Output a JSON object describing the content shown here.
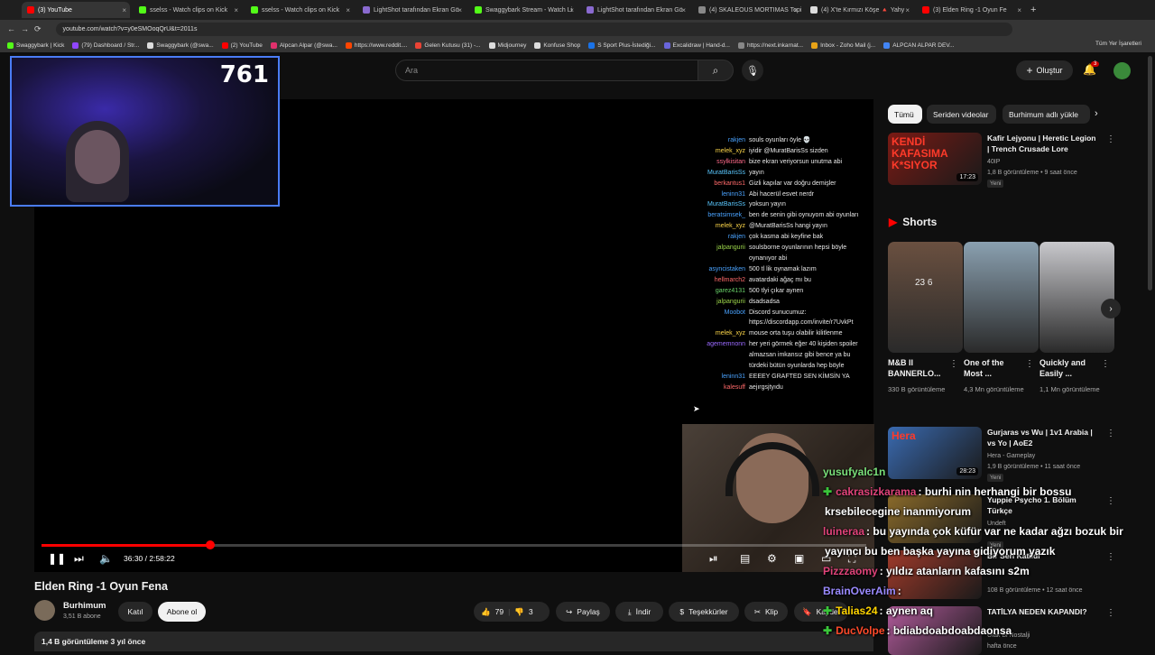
{
  "browser": {
    "tabs": [
      {
        "label": "(3) YouTube",
        "color": "#ff0000"
      },
      {
        "label": "sselss - Watch clips on Kick",
        "color": "#53fc18"
      },
      {
        "label": "sselss - Watch clips on Kick",
        "color": "#53fc18"
      },
      {
        "label": "LightShot tarafından Ekran Gö",
        "color": "#8a6ad0"
      },
      {
        "label": "Swaggybark Stream - Watch Li",
        "color": "#53fc18"
      },
      {
        "label": "LightShot tarafından Ekran Gö",
        "color": "#8a6ad0"
      },
      {
        "label": "(4) SKALEOUS MORTIMAS Topi",
        "color": "#888888"
      },
      {
        "label": "(4) X'te Kırmızı Köşe 🔺 Yahy",
        "color": "#dddddd"
      },
      {
        "label": "(3) Elden Ring -1 Oyun Fe",
        "color": "#ff0000"
      }
    ],
    "new_tab": "+",
    "nav": {
      "back": "←",
      "forward": "→",
      "reload": "⟳"
    },
    "url": "youtube.com/watch?v=y0eSMOoqQrU&t=2011s",
    "bookmarks": [
      {
        "label": "Swaggybark | Kick",
        "color": "#53fc18"
      },
      {
        "label": "(79) Dashboard / Str...",
        "color": "#9146ff"
      },
      {
        "label": "Swaggybark (@swa...",
        "color": "#dddddd"
      },
      {
        "label": "(2) YouTube",
        "color": "#ff0000"
      },
      {
        "label": "Alpcan Alpar (@swa...",
        "color": "#e1306c"
      },
      {
        "label": "https://www.reddit....",
        "color": "#ff4500"
      },
      {
        "label": "Gelen Kutusu (31) -...",
        "color": "#ea4335"
      },
      {
        "label": "Midjourney",
        "color": "#dddddd"
      },
      {
        "label": "Konfuse Shop",
        "color": "#dddddd"
      },
      {
        "label": "S Sport Plus-İstediği...",
        "color": "#1a73e8"
      },
      {
        "label": "Excalidraw | Hand-d...",
        "color": "#6965db"
      },
      {
        "label": "https://next.inkarnat...",
        "color": "#888888"
      },
      {
        "label": "Inbox - Zoho Mail (j...",
        "color": "#e8a317"
      },
      {
        "label": "ALPCAN ALPAR DEV...",
        "color": "#4285f4"
      }
    ],
    "all_bookmarks": "Tüm Yer İşaretleri"
  },
  "header": {
    "search_placeholder": "Ara",
    "search_icon": "search-icon",
    "create_label": "Oluştur",
    "notifications_count": "3"
  },
  "player": {
    "viewer_count": "761",
    "time": "36:30 / 2:58:22",
    "progress": 0.205,
    "chat": [
      {
        "name": "rakjen",
        "text": "souls oyunları öyle 💀",
        "color": "#4aa3ff",
        "badge": true
      },
      {
        "name": "melek_xyz",
        "text": "iyidir @MuratBarisSs sizden",
        "color": "#ffd84a",
        "badge": false
      },
      {
        "name": "ssylkisitan",
        "text": "bize ekran veriyorsun unutma abi",
        "color": "#ff6a8a",
        "badge": false
      },
      {
        "name": "MuratBarisSs",
        "text": "yayın",
        "color": "#5ac8ff",
        "badge": false
      },
      {
        "name": "berkantus1",
        "text": "Gizli kapılar var doğru demişler",
        "color": "#ff6a6a",
        "badge": true
      },
      {
        "name": "leninn31",
        "text": "Abi hacerül esvet nerdr",
        "color": "#4aa3ff",
        "badge": false
      },
      {
        "name": "MuratBarisSs",
        "text": "yoksun yayın",
        "color": "#5ac8ff",
        "badge": false
      },
      {
        "name": "beratsimsek_",
        "text": "ben de senin gibi oynuyom abi oyunları",
        "color": "#4aa3ff",
        "badge": true
      },
      {
        "name": "melek_xyz",
        "text": "@MuratBarisSs hangi yayın",
        "color": "#ffd84a",
        "badge": false
      },
      {
        "name": "rakjen",
        "text": "çok kasma abi keyfine bak",
        "color": "#4aa3ff",
        "badge": true
      },
      {
        "name": "jalpangurii",
        "text": "soulsborne oyunlarının hepsi böyle",
        "color": "#9bd44a",
        "badge": false
      },
      {
        "name": "",
        "text": "oynanıyor abi",
        "color": "#9bd44a",
        "badge": false
      },
      {
        "name": "asyncistaken",
        "text": "500 tl lik oynamak lazım",
        "color": "#4aa3ff",
        "badge": true
      },
      {
        "name": "hellmarch2",
        "text": "avatardaki ağaç mı bu",
        "color": "#ff6a6a",
        "badge": false
      },
      {
        "name": "garez4131",
        "text": "500 tlyi çıkar aynen",
        "color": "#6ad46a",
        "badge": true
      },
      {
        "name": "jalpangurii",
        "text": "dsadsadsa",
        "color": "#9bd44a",
        "badge": false
      },
      {
        "name": "Moobot",
        "text": "Discord sunucumuz:",
        "color": "#4aa3ff",
        "badge": true
      },
      {
        "name": "",
        "text": "https://discordapp.com/invite/r7UvkPt",
        "color": "#4aa3ff",
        "badge": false
      },
      {
        "name": "melek_xyz",
        "text": "mouse orta tuşu olabilir kilitlenme",
        "color": "#ffd84a",
        "badge": false
      },
      {
        "name": "agememnonn",
        "text": "her yeri görmek eğer 40 kişiden spoiler",
        "color": "#9a6aff",
        "badge": true
      },
      {
        "name": "",
        "text": "almazsan imkansız gibi bence ya bu",
        "color": "#9a6aff",
        "badge": false
      },
      {
        "name": "",
        "text": "türdeki bütün oyunlarda hep böyle",
        "color": "#9a6aff",
        "badge": false
      },
      {
        "name": "leninn31",
        "text": "EEEEY GRAFTED SEN KİMSİN YA",
        "color": "#4aa3ff",
        "badge": false
      },
      {
        "name": "kalesuff",
        "text": "aejırgsjtyıdu",
        "color": "#ff6a6a",
        "badge": true
      }
    ]
  },
  "video": {
    "title": "Elden Ring -1 Oyun Fena",
    "channel": "Burhimum",
    "subscribers": "3,51 B abone",
    "join_label": "Katıl",
    "subscribe_label": "Abone ol",
    "likes": "79",
    "dislikes": "3",
    "share_label": "Paylaş",
    "download_label": "İndir",
    "thanks_label": "Teşekkürler",
    "clip_label": "Klip",
    "save_label": "Kaydet",
    "views_age": "1,4 B görüntüleme  3 yıl önce"
  },
  "sidebar": {
    "chips": [
      "Tümü",
      "Seriden videolar",
      "Burhimum adlı yükle"
    ],
    "videos": [
      {
        "title": "Kafir Lejyonu | Heretic Legion | Trench Crusade Lore",
        "channel": "40IP",
        "meta": "1,8 B görüntüleme • 9 saat önce",
        "badge": "Yeni",
        "duration": "17:23",
        "thumb_text": "KENDİ KAFASIMA K*SIYOR",
        "color": "#7a1a14"
      },
      {
        "title": "Gurjaras vs Wu | 1v1 Arabia | vs Yo | AoE2",
        "channel": "Hera - Gameplay",
        "meta": "1,9 B görüntüleme • 11 saat önce",
        "badge": "Yeni",
        "duration": "28:23",
        "thumb_text": "Hera",
        "color": "#3a6ab0"
      },
      {
        "title": "Yuppie Psycho 1. Bölüm Türkçe",
        "channel": "Undeft",
        "meta": "",
        "badge": "Yeni",
        "duration": "",
        "thumb_text": "",
        "color": "#8a6a2a"
      },
      {
        "title": "Bir Seri Katildi",
        "channel": "",
        "meta": "108 B görüntüleme • 12 saat önce",
        "badge": "",
        "duration": "",
        "thumb_text": "",
        "color": "#a03a2a"
      },
      {
        "title": "TATİLYA NEDEN KAPANDI?",
        "channel": "Ufak Bi Nostalji",
        "meta": "hafta önce",
        "badge": "",
        "duration": "",
        "thumb_text": "",
        "color": "#b05a9a"
      }
    ],
    "shorts_label": "Shorts",
    "shorts": [
      {
        "title": "M&B II BANNERLO...",
        "views": "330 B görüntüleme",
        "color": "#6a5040",
        "overlay": "23 6"
      },
      {
        "title": "One of the Most ...",
        "views": "4,3 Mn görüntüleme",
        "color": "#8aa0b0",
        "overlay": ""
      },
      {
        "title": "Quickly and Easily ...",
        "views": "1,1 Mn görüntüleme",
        "color": "#c8c8cc",
        "overlay": ""
      }
    ]
  },
  "overlay_chat": [
    {
      "name": "yusufyalc1n",
      "text": "",
      "name_color": "#7ae07a",
      "icon": ""
    },
    {
      "name": "cakrasizkarama",
      "text": ": burhi nin herhangi bir bossu",
      "name_color": "#e0437a",
      "icon": "✚"
    },
    {
      "name": "",
      "text": "krsebilecegine inanmiyorum",
      "name_color": "#e0437a",
      "icon": ""
    },
    {
      "name": "luineraa",
      "text": ": bu yayında çok küfür var ne kadar ağzı bozuk bir",
      "name_color": "#e0437a",
      "icon": ""
    },
    {
      "name": "",
      "text": "yayıncı bu ben başka yayına gidiyorum yazık",
      "name_color": "#e0437a",
      "icon": ""
    },
    {
      "name": "Pizzzaomy",
      "text": ": yıldız atanların kafasını s2m",
      "name_color": "#e0437a",
      "icon": ""
    },
    {
      "name": "BrainOverAim",
      "text": ":",
      "name_color": "#9a8aff",
      "icon": ""
    },
    {
      "name": "Talias24",
      "text": ": aynen aq",
      "name_color": "#ffd400",
      "icon": "✚"
    },
    {
      "name": "DucVolpe",
      "text": ": bdiabdoabdoabdaonsa",
      "name_color": "#ff4a2a",
      "icon": "✚"
    }
  ]
}
